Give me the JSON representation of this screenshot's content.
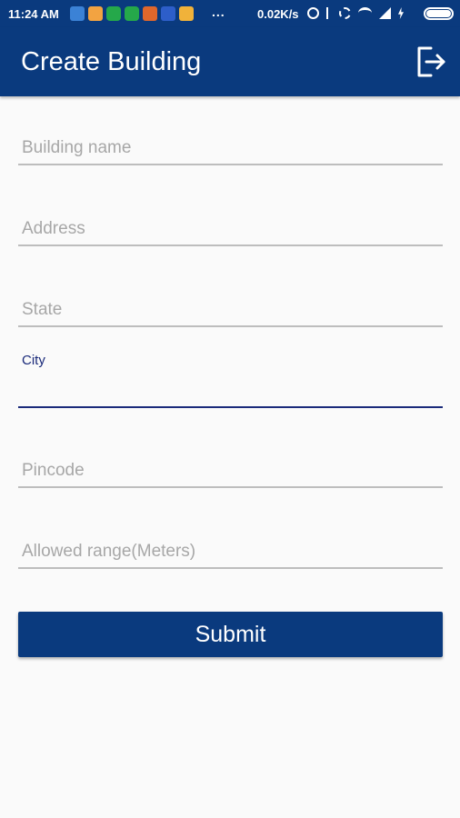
{
  "status_bar": {
    "time": "11:24 AM",
    "more_indicator": "...",
    "network_speed": "0.02K/s",
    "notification_icons": [
      "location-icon",
      "app-icon",
      "whatsapp-icon",
      "whatsapp-icon",
      "app-icon",
      "triangle-app-icon",
      "note-icon"
    ],
    "system_icons": [
      "nfc-icon",
      "bluetooth-icon",
      "sync-icon",
      "wifi-icon",
      "signal-icon",
      "charging-icon",
      "battery-icon"
    ]
  },
  "app_bar": {
    "title": "Create Building",
    "action_icon": "logout-icon"
  },
  "form": {
    "building_name": {
      "placeholder": "Building name",
      "value": ""
    },
    "address": {
      "placeholder": "Address",
      "value": ""
    },
    "state": {
      "placeholder": "State",
      "value": ""
    },
    "city": {
      "label": "City",
      "value": ""
    },
    "pincode": {
      "placeholder": "Pincode",
      "value": ""
    },
    "allowed_range": {
      "placeholder": "Allowed range(Meters)",
      "value": ""
    },
    "submit_label": "Submit"
  },
  "colors": {
    "primary": "#0a3a7e",
    "focused_field": "#1a2a7a",
    "background": "#fafafa",
    "placeholder": "#a7a7a7",
    "underline": "#bdbdbd"
  }
}
